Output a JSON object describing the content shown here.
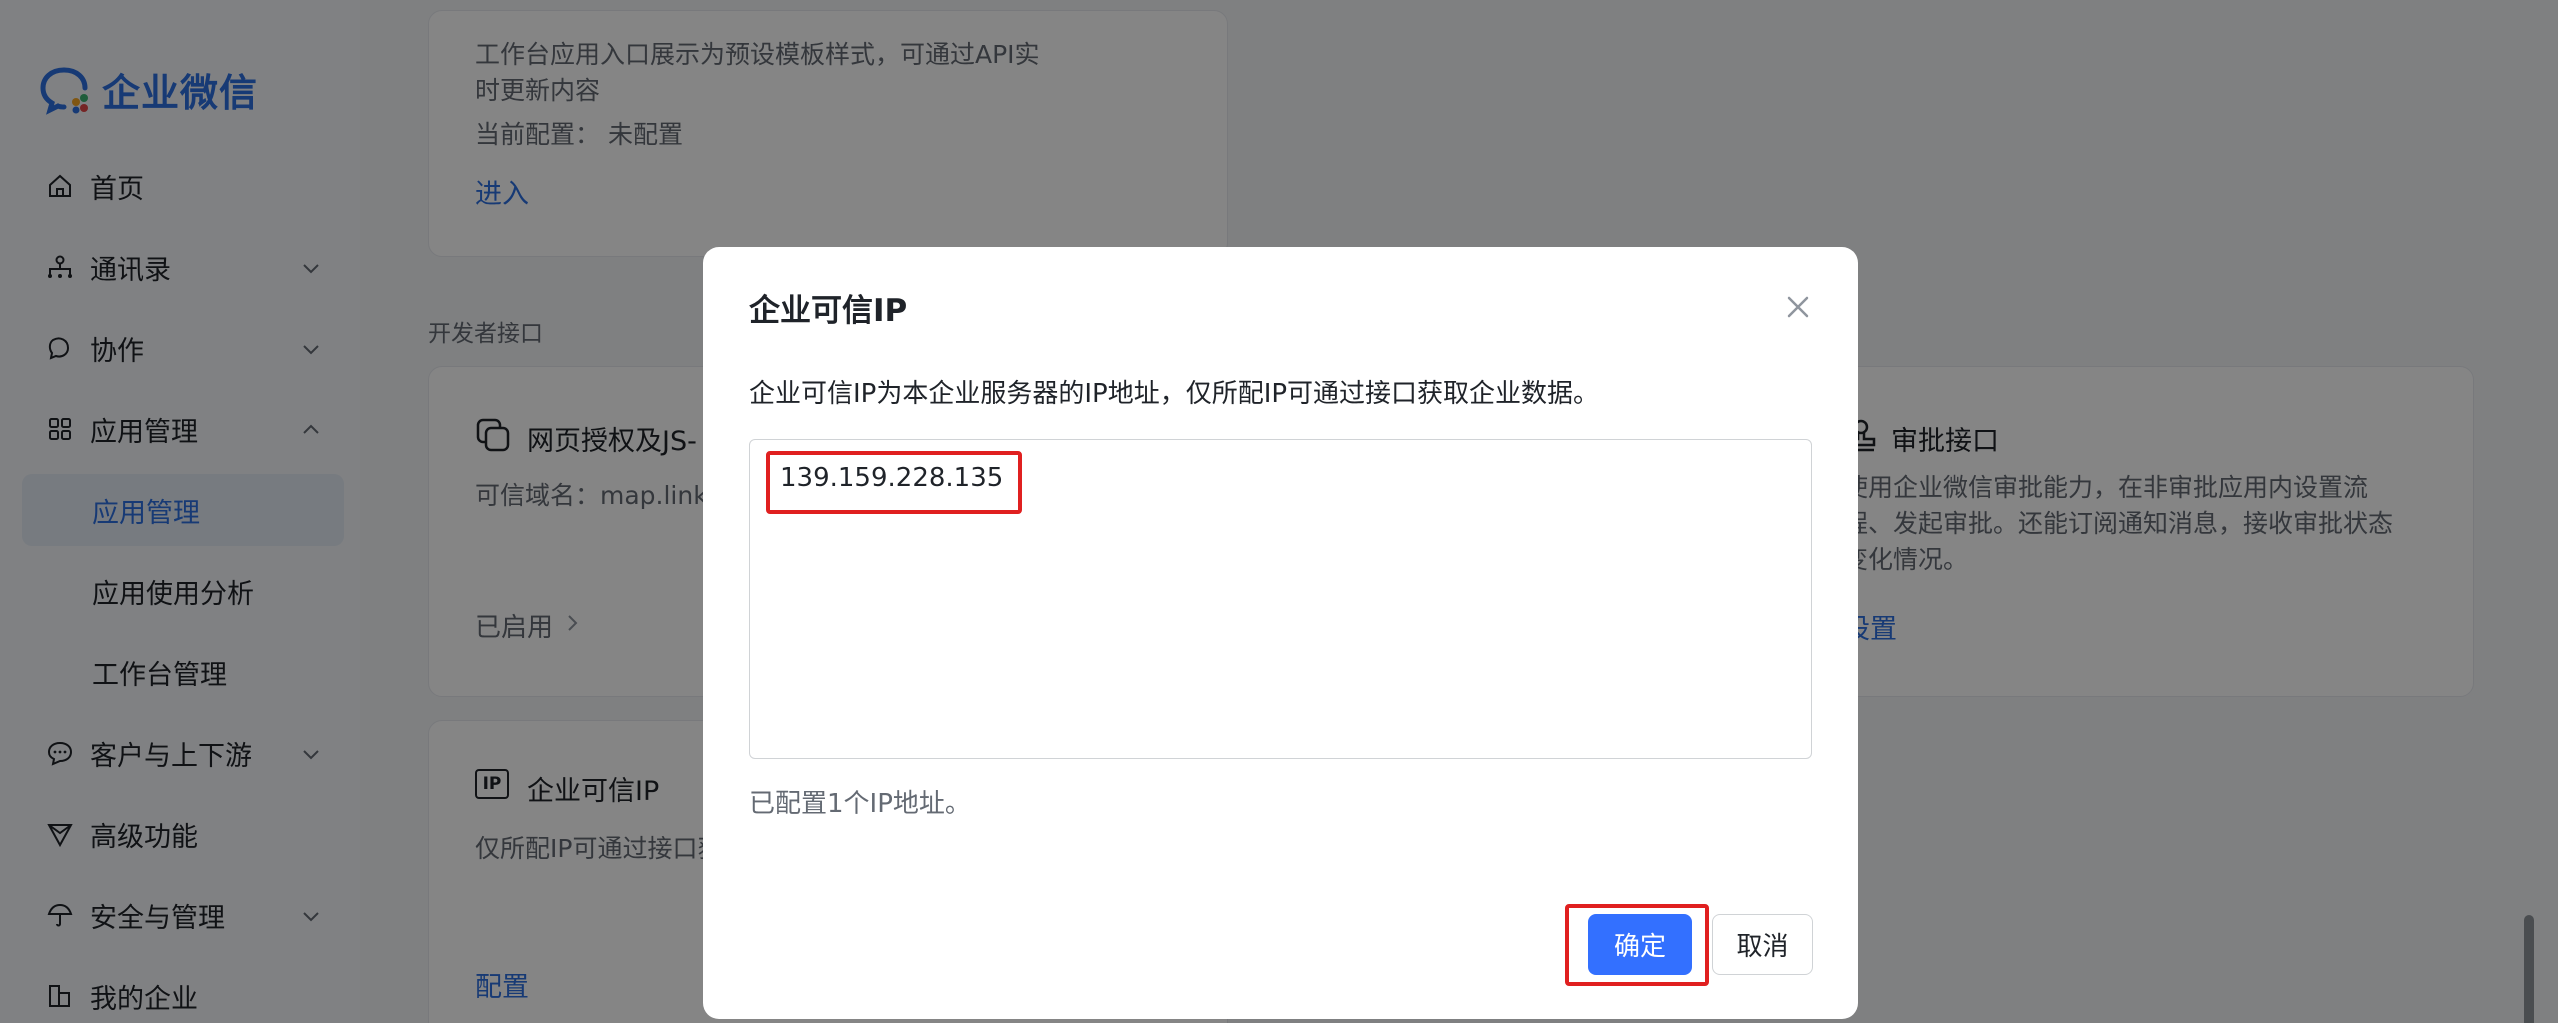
{
  "sidebar": {
    "logo_text": "企业微信",
    "items": [
      {
        "label": "首页"
      },
      {
        "label": "通讯录"
      },
      {
        "label": "协作"
      },
      {
        "label": "应用管理"
      },
      {
        "label": "应用管理"
      },
      {
        "label": "应用使用分析"
      },
      {
        "label": "工作台管理"
      },
      {
        "label": "客户与上下游"
      },
      {
        "label": "高级功能"
      },
      {
        "label": "安全与管理"
      },
      {
        "label": "我的企业"
      }
    ]
  },
  "main": {
    "workbench_card": {
      "desc_line1": "工作台应用入口展示为预设模板样式，可通过API实",
      "desc_line2": "时更新内容",
      "config_label": "当前配置：",
      "config_value": "未配置",
      "enter_link": "进入"
    },
    "section_title": "开发者接口",
    "oauth_card": {
      "title": "网页授权及JS-",
      "domain": "可信域名：map.link",
      "status": "已启用"
    },
    "approval_card": {
      "title": "审批接口",
      "desc_line1": "使用企业微信审批能力，在非审批应用内设置流",
      "desc_line2": "程、发起审批。还能订阅通知消息，接收审批状态",
      "desc_line3": "变化情况。",
      "link": "设置"
    },
    "trusted_ip_card": {
      "icon_text": "IP",
      "title": "企业可信IP",
      "desc": "仅所配IP可通过接口获",
      "link": "配置"
    }
  },
  "modal": {
    "title": "企业可信IP",
    "description": "企业可信IP为本企业服务器的IP地址，仅所配IP可通过接口获取企业数据。",
    "ip_value": "139.159.228.135",
    "status": "已配置1个IP地址。",
    "confirm_label": "确定",
    "cancel_label": "取消"
  },
  "colors": {
    "accent": "#3370ff",
    "brand": "#2d70e0",
    "highlight": "#e02020",
    "overlay": "rgba(0,0,0,0.48)"
  },
  "icons": [
    "home-icon",
    "contacts-icon",
    "collab-icon",
    "apps-icon",
    "customer-icon",
    "advanced-icon",
    "security-icon",
    "company-icon",
    "close-icon",
    "chevron-down-icon",
    "chevron-up-icon",
    "chevron-right-icon",
    "copy-icon",
    "stamp-icon",
    "ip-icon"
  ]
}
